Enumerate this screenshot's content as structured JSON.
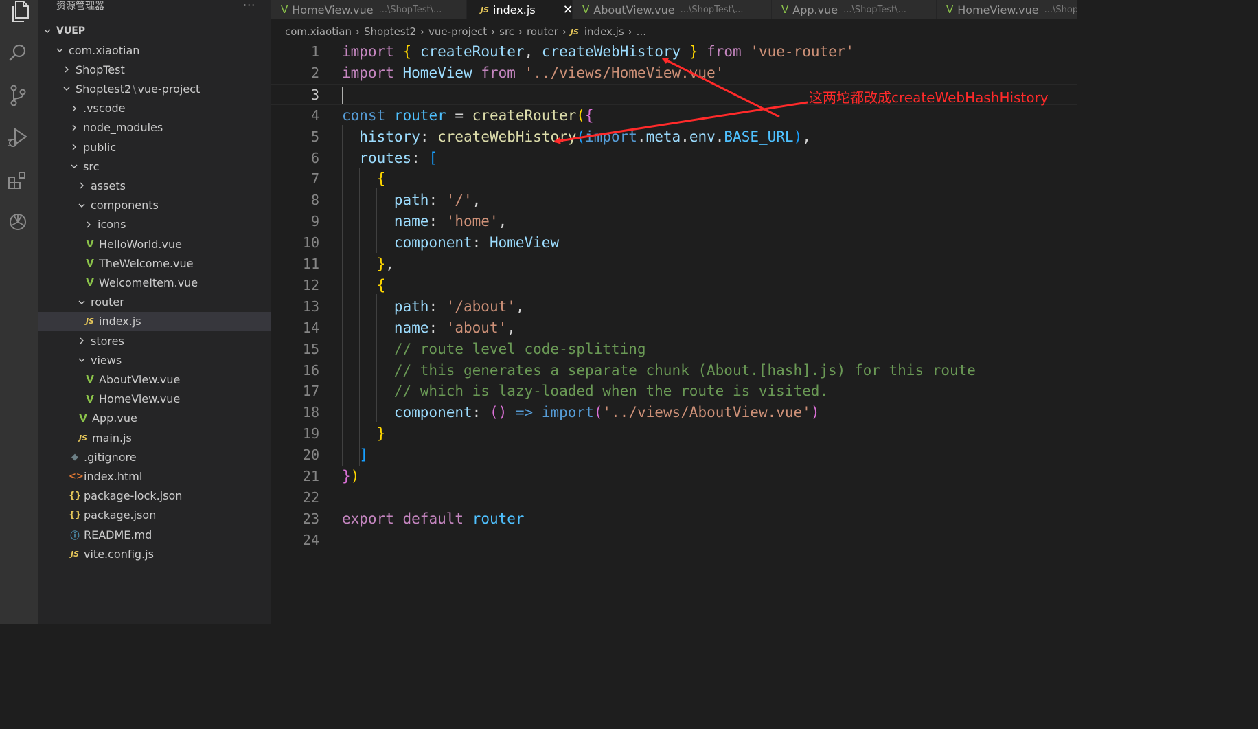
{
  "sidebar": {
    "title": "资源管理器",
    "more": "···",
    "root": "VUEP",
    "tree": [
      {
        "label": "com.xiaotian",
        "type": "folder-open"
      },
      {
        "label": "ShopTest",
        "type": "folder"
      },
      {
        "label": "Shoptest2",
        "label2": "vue-project",
        "sep": "\\",
        "type": "folder-open"
      },
      {
        "label": ".vscode",
        "type": "folder"
      },
      {
        "label": "node_modules",
        "type": "folder"
      },
      {
        "label": "public",
        "type": "folder"
      },
      {
        "label": "src",
        "type": "folder-open"
      },
      {
        "label": "assets",
        "type": "folder"
      },
      {
        "label": "components",
        "type": "folder-open"
      },
      {
        "label": "icons",
        "type": "folder"
      },
      {
        "label": "HelloWorld.vue",
        "type": "vue"
      },
      {
        "label": "TheWelcome.vue",
        "type": "vue"
      },
      {
        "label": "WelcomeItem.vue",
        "type": "vue"
      },
      {
        "label": "router",
        "type": "folder-open"
      },
      {
        "label": "index.js",
        "type": "js"
      },
      {
        "label": "stores",
        "type": "folder"
      },
      {
        "label": "views",
        "type": "folder-open"
      },
      {
        "label": "AboutView.vue",
        "type": "vue"
      },
      {
        "label": "HomeView.vue",
        "type": "vue"
      },
      {
        "label": "App.vue",
        "type": "vue"
      },
      {
        "label": "main.js",
        "type": "js"
      },
      {
        "label": ".gitignore",
        "type": "git"
      },
      {
        "label": "index.html",
        "type": "html"
      },
      {
        "label": "package-lock.json",
        "type": "json"
      },
      {
        "label": "package.json",
        "type": "json"
      },
      {
        "label": "README.md",
        "type": "info"
      },
      {
        "label": "vite.config.js",
        "type": "js"
      }
    ]
  },
  "icons": {
    "vue": "V",
    "js": "JS",
    "json": "{}",
    "html": "<>",
    "git": "◆",
    "info": "ⓘ"
  },
  "tabs": [
    {
      "label": "HomeView.vue",
      "path": "...\\ShopTest\\...",
      "icon": "vue"
    },
    {
      "label": "index.js",
      "path": "",
      "icon": "js",
      "close": "✕"
    },
    {
      "label": "AboutView.vue",
      "path": "...\\ShopTest\\...",
      "icon": "vue"
    },
    {
      "label": "App.vue",
      "path": "...\\ShopTest\\...",
      "icon": "vue"
    },
    {
      "label": "HomeView.vue",
      "path": "...\\Shop",
      "icon": "vue"
    }
  ],
  "breadcrumb": {
    "items": [
      "com.xiaotian",
      "Shoptest2",
      "vue-project",
      "src",
      "router"
    ],
    "file_icon": "JS",
    "file": "index.js",
    "more": "..."
  },
  "editor": {
    "current_line": 3,
    "lines": [
      {
        "n": "1",
        "t": [
          [
            "kw",
            "import"
          ],
          [
            "pun",
            " "
          ],
          [
            "br1",
            "{"
          ],
          [
            "pun",
            " "
          ],
          [
            "var",
            "createRouter"
          ],
          [
            "pun",
            ", "
          ],
          [
            "var",
            "createWebHistory"
          ],
          [
            "pun",
            " "
          ],
          [
            "br1",
            "}"
          ],
          [
            "pun",
            " "
          ],
          [
            "kw",
            "from"
          ],
          [
            "pun",
            " "
          ],
          [
            "str",
            "'vue-router'"
          ]
        ]
      },
      {
        "n": "2",
        "t": [
          [
            "kw",
            "import"
          ],
          [
            "pun",
            " "
          ],
          [
            "var",
            "HomeView"
          ],
          [
            "pun",
            " "
          ],
          [
            "kw",
            "from"
          ],
          [
            "pun",
            " "
          ],
          [
            "str",
            "'../views/HomeView.vue'"
          ]
        ]
      },
      {
        "n": "3",
        "t": []
      },
      {
        "n": "4",
        "t": [
          [
            "kw2",
            "const"
          ],
          [
            "pun",
            " "
          ],
          [
            "cst",
            "router"
          ],
          [
            "pun",
            " = "
          ],
          [
            "fn",
            "createRouter"
          ],
          [
            "br1",
            "("
          ],
          [
            "br2",
            "{"
          ]
        ]
      },
      {
        "n": "5",
        "t": [
          [
            "pun",
            "  "
          ],
          [
            "prop",
            "history"
          ],
          [
            "pun",
            ": "
          ],
          [
            "fn",
            "createWebHistory"
          ],
          [
            "br3",
            "("
          ],
          [
            "kw2",
            "import"
          ],
          [
            "pun",
            "."
          ],
          [
            "prop",
            "meta"
          ],
          [
            "pun",
            "."
          ],
          [
            "prop",
            "env"
          ],
          [
            "pun",
            "."
          ],
          [
            "cst",
            "BASE_URL"
          ],
          [
            "br3",
            ")"
          ],
          [
            "pun",
            ","
          ]
        ]
      },
      {
        "n": "6",
        "t": [
          [
            "pun",
            "  "
          ],
          [
            "prop",
            "routes"
          ],
          [
            "pun",
            ": "
          ],
          [
            "br3",
            "["
          ]
        ]
      },
      {
        "n": "7",
        "t": [
          [
            "pun",
            "    "
          ],
          [
            "br1",
            "{"
          ]
        ]
      },
      {
        "n": "8",
        "t": [
          [
            "pun",
            "      "
          ],
          [
            "prop",
            "path"
          ],
          [
            "pun",
            ": "
          ],
          [
            "str",
            "'/'"
          ],
          [
            "pun",
            ","
          ]
        ]
      },
      {
        "n": "9",
        "t": [
          [
            "pun",
            "      "
          ],
          [
            "prop",
            "name"
          ],
          [
            "pun",
            ": "
          ],
          [
            "str",
            "'home'"
          ],
          [
            "pun",
            ","
          ]
        ]
      },
      {
        "n": "10",
        "t": [
          [
            "pun",
            "      "
          ],
          [
            "prop",
            "component"
          ],
          [
            "pun",
            ": "
          ],
          [
            "var",
            "HomeView"
          ]
        ]
      },
      {
        "n": "11",
        "t": [
          [
            "pun",
            "    "
          ],
          [
            "br1",
            "}"
          ],
          [
            "pun",
            ","
          ]
        ]
      },
      {
        "n": "12",
        "t": [
          [
            "pun",
            "    "
          ],
          [
            "br1",
            "{"
          ]
        ]
      },
      {
        "n": "13",
        "t": [
          [
            "pun",
            "      "
          ],
          [
            "prop",
            "path"
          ],
          [
            "pun",
            ": "
          ],
          [
            "str",
            "'/about'"
          ],
          [
            "pun",
            ","
          ]
        ]
      },
      {
        "n": "14",
        "t": [
          [
            "pun",
            "      "
          ],
          [
            "prop",
            "name"
          ],
          [
            "pun",
            ": "
          ],
          [
            "str",
            "'about'"
          ],
          [
            "pun",
            ","
          ]
        ]
      },
      {
        "n": "15",
        "t": [
          [
            "pun",
            "      "
          ],
          [
            "cm",
            "// route level code-splitting"
          ]
        ]
      },
      {
        "n": "16",
        "t": [
          [
            "pun",
            "      "
          ],
          [
            "cm",
            "// this generates a separate chunk (About.[hash].js) for this route"
          ]
        ]
      },
      {
        "n": "17",
        "t": [
          [
            "pun",
            "      "
          ],
          [
            "cm",
            "// which is lazy-loaded when the route is visited."
          ]
        ]
      },
      {
        "n": "18",
        "t": [
          [
            "pun",
            "      "
          ],
          [
            "prop",
            "component"
          ],
          [
            "pun",
            ": "
          ],
          [
            "br2",
            "()"
          ],
          [
            "pun",
            " "
          ],
          [
            "kw2",
            "=>"
          ],
          [
            "pun",
            " "
          ],
          [
            "kw2",
            "import"
          ],
          [
            "br2",
            "("
          ],
          [
            "str",
            "'../views/AboutView.vue'"
          ],
          [
            "br2",
            ")"
          ]
        ]
      },
      {
        "n": "19",
        "t": [
          [
            "pun",
            "    "
          ],
          [
            "br1",
            "}"
          ]
        ]
      },
      {
        "n": "20",
        "t": [
          [
            "pun",
            "  "
          ],
          [
            "br3",
            "]"
          ]
        ]
      },
      {
        "n": "21",
        "t": [
          [
            "br2",
            "}"
          ],
          [
            "br1",
            ")"
          ]
        ]
      },
      {
        "n": "22",
        "t": []
      },
      {
        "n": "23",
        "t": [
          [
            "kw",
            "export"
          ],
          [
            "pun",
            " "
          ],
          [
            "kw",
            "default"
          ],
          [
            "pun",
            " "
          ],
          [
            "cst",
            "router"
          ]
        ]
      },
      {
        "n": "24",
        "t": []
      }
    ]
  },
  "annotation": {
    "text": "这两坨都改成createWebHashHistory",
    "color": "#ff2a2a"
  }
}
